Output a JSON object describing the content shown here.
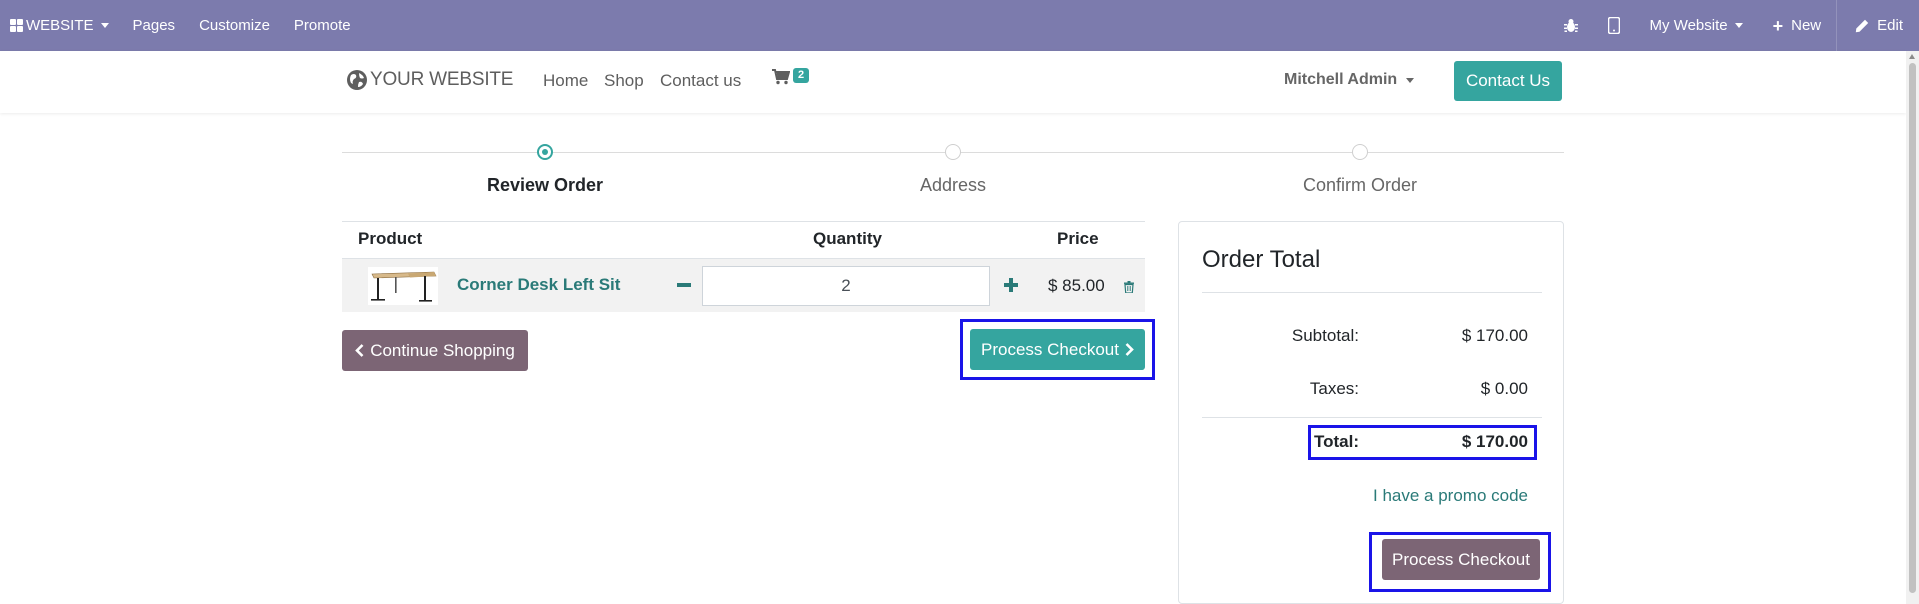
{
  "admin_bar": {
    "apps_menu_label": "WEBSITE",
    "pages_label": "Pages",
    "customize_label": "Customize",
    "promote_label": "Promote",
    "website_switcher_label": "My Website",
    "new_label": "New",
    "edit_label": "Edit",
    "icons": [
      "apps-grid-icon",
      "bug-icon",
      "mobile-icon",
      "plus-icon",
      "pencil-icon"
    ]
  },
  "site_header": {
    "logo_text": "YOUR WEBSITE",
    "nav": [
      "Home",
      "Shop",
      "Contact us"
    ],
    "cart_count": "2",
    "user_name": "Mitchell Admin",
    "contact_button_label": "Contact Us",
    "accent_color": "#35a59f"
  },
  "wizard": {
    "steps": [
      "Review Order",
      "Address",
      "Confirm Order"
    ],
    "active_step": "Review Order"
  },
  "cart_table": {
    "headers": {
      "product": "Product",
      "quantity": "Quantity",
      "price": "Price"
    },
    "rows": [
      {
        "name": "Corner Desk Left Sit",
        "quantity": "2",
        "price": "$ 85.00"
      }
    ]
  },
  "actions": {
    "continue_label": "Continue Shopping",
    "process_checkout_label": "Process Checkout"
  },
  "order_total": {
    "title": "Order Total",
    "subtotal_label": "Subtotal:",
    "subtotal_value": "$ 170.00",
    "taxes_label": "Taxes:",
    "taxes_value": "$ 0.00",
    "total_label": "Total:",
    "total_value": "$ 170.00",
    "promo_label": "I have a promo code",
    "process_checkout_label": "Process Checkout"
  },
  "colors": {
    "admin_bar": "#7c7bad",
    "secondary_button": "#7c6575",
    "link": "#2a7a78",
    "highlight_box": "#1a14e8"
  }
}
